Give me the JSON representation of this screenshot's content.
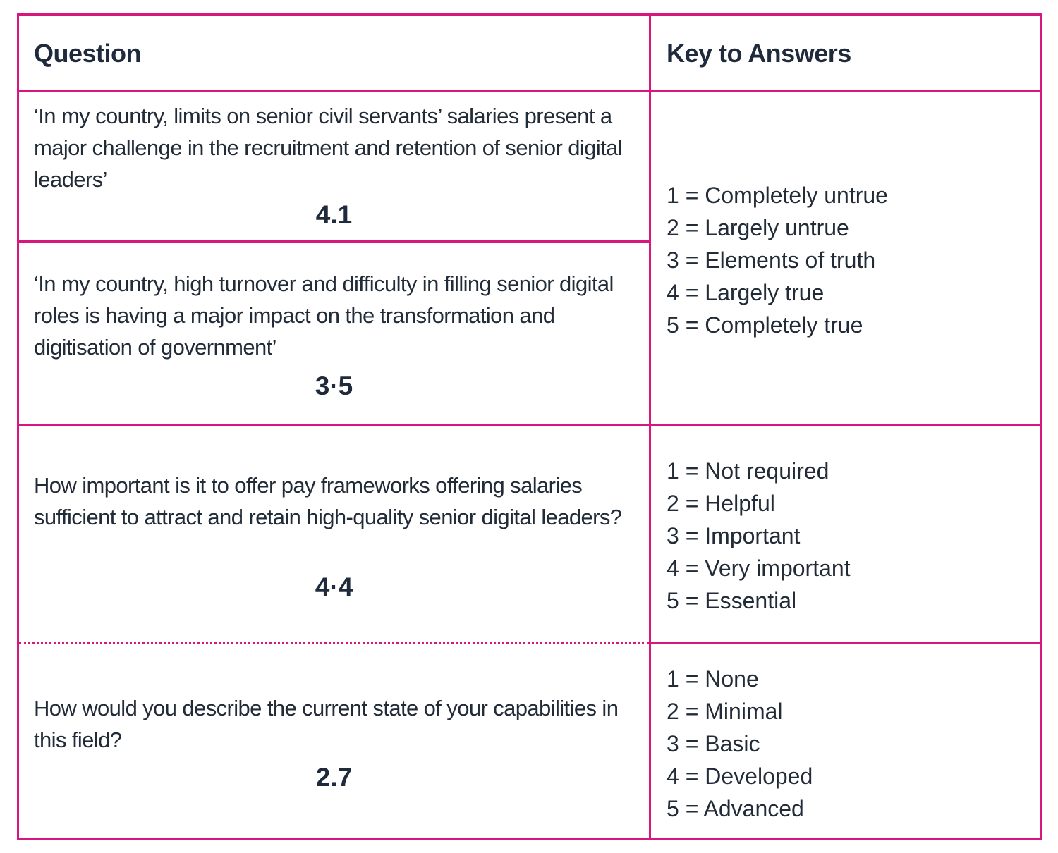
{
  "table": {
    "headers": {
      "question": "Question",
      "key": "Key to Answers"
    },
    "questions": [
      {
        "text": "‘In my country, limits on senior civil servants’ salaries present a major challenge in the recruitment and retention of senior digital leaders’",
        "score": "4.1"
      },
      {
        "text": "‘In my country, high turnover and difficulty in filling senior digital roles is having a major impact on the transformation and digitisation of government’",
        "score": "3·5"
      },
      {
        "text": "How important is it to offer pay frameworks offering salaries sufficient to attract and retain high-quality senior digital leaders?",
        "score": "4·4"
      },
      {
        "text": "How would you describe the current state of your capabilities in this field?",
        "score": "2.7"
      }
    ],
    "keys": [
      {
        "items": [
          "1 = Completely untrue",
          "2 = Largely untrue",
          "3 = Elements of truth",
          "4 = Largely true",
          "5 = Completely true"
        ]
      },
      {
        "items": [
          "1 = Not required",
          "2 = Helpful",
          "3 = Important",
          "4 = Very important",
          "5 = Essential"
        ]
      },
      {
        "items": [
          "1 = None",
          "2 = Minimal",
          "3 = Basic",
          "4 = Developed",
          "5 = Advanced"
        ]
      }
    ]
  },
  "colors": {
    "border": "#d8177e",
    "text": "#1f2a3c"
  }
}
